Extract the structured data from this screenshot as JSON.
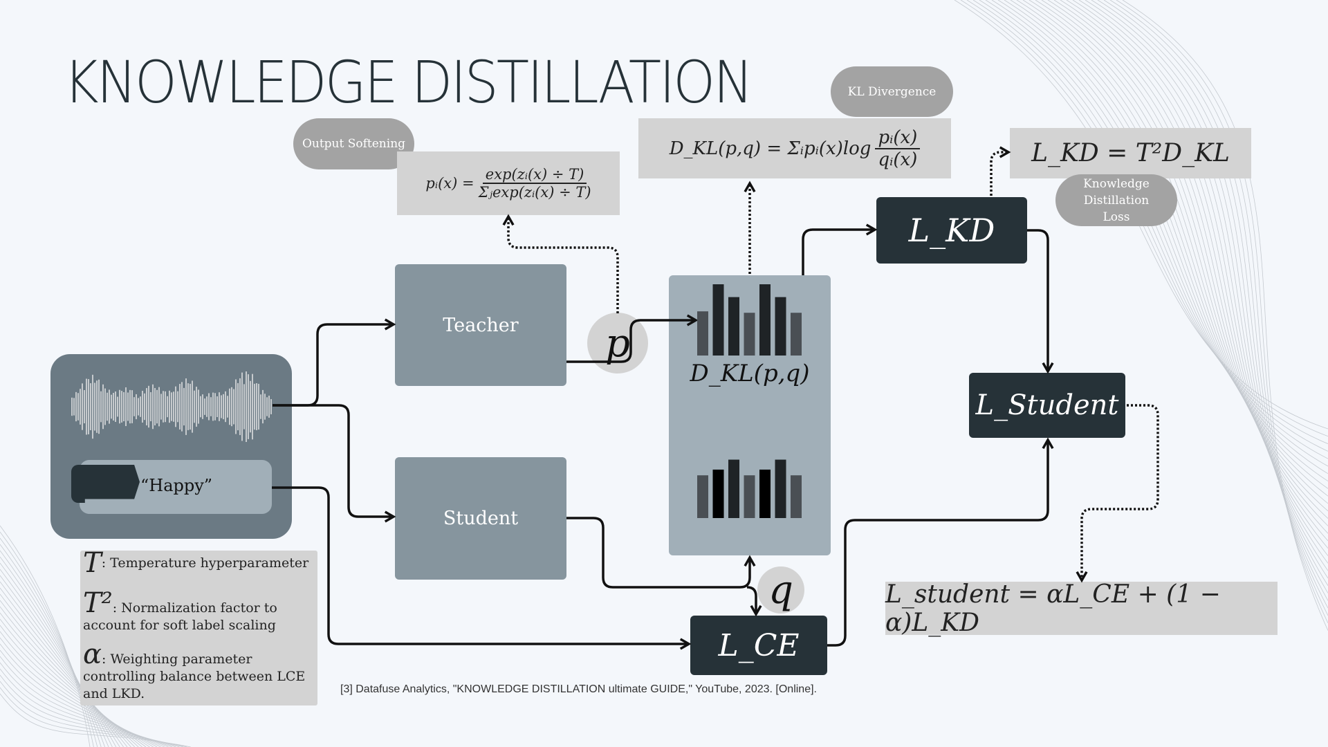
{
  "title": "KNOWLEDGE DISTILLATION",
  "labels": {
    "output_softening": "Output Softening",
    "kl_divergence": "KL Divergence",
    "kd_loss": "Knowledge Distillation Loss",
    "teacher": "Teacher",
    "student": "Student",
    "happy": "“Happy”",
    "p": "p",
    "q": "q"
  },
  "formulas": {
    "softmax_lhs": "pᵢ(x) =",
    "softmax_num": "exp(zᵢ(x) ÷ T)",
    "softmax_den": "Σⱼexp(zᵢ(x) ÷ T)",
    "dkl_lhs": "D_KL(p,q) = Σᵢpᵢ(x)log",
    "dkl_num": "pᵢ(x)",
    "dkl_den": "qᵢ(x)",
    "lkd": "L_KD = T²D_KL",
    "lstudent": "L_student = αL_CE + (1 − α)L_KD",
    "panel_dkl": "D_KL(p,q)",
    "box_lkd": "L_KD",
    "box_lstudent": "L_Student",
    "box_lce": "L_CE"
  },
  "legend": [
    {
      "symbol": "T",
      "text": ": Temperature hyperparameter"
    },
    {
      "symbol": "T²",
      "text": ": Normalization factor to account for soft label scaling"
    },
    {
      "symbol": "α",
      "text": ": Weighting parameter controlling balance between LCE and LKD."
    }
  ],
  "citation": "[3] Datafuse Analytics, \"KNOWLEDGE DISTILLATION ultimate GUIDE,\" YouTube, 2023. [Online].",
  "colors": {
    "dark": "#263238",
    "grey_box": "#86959e",
    "panel": "#a1afb8",
    "formula_bg": "#d3d3d3",
    "pill": "#a3a3a3"
  },
  "bars_teacher": [
    0.62,
    1.0,
    0.82,
    0.6,
    1.0,
    0.82,
    0.6
  ],
  "bars_student": [
    0.6,
    0.68,
    0.82,
    0.6,
    0.68,
    0.82,
    0.6
  ]
}
